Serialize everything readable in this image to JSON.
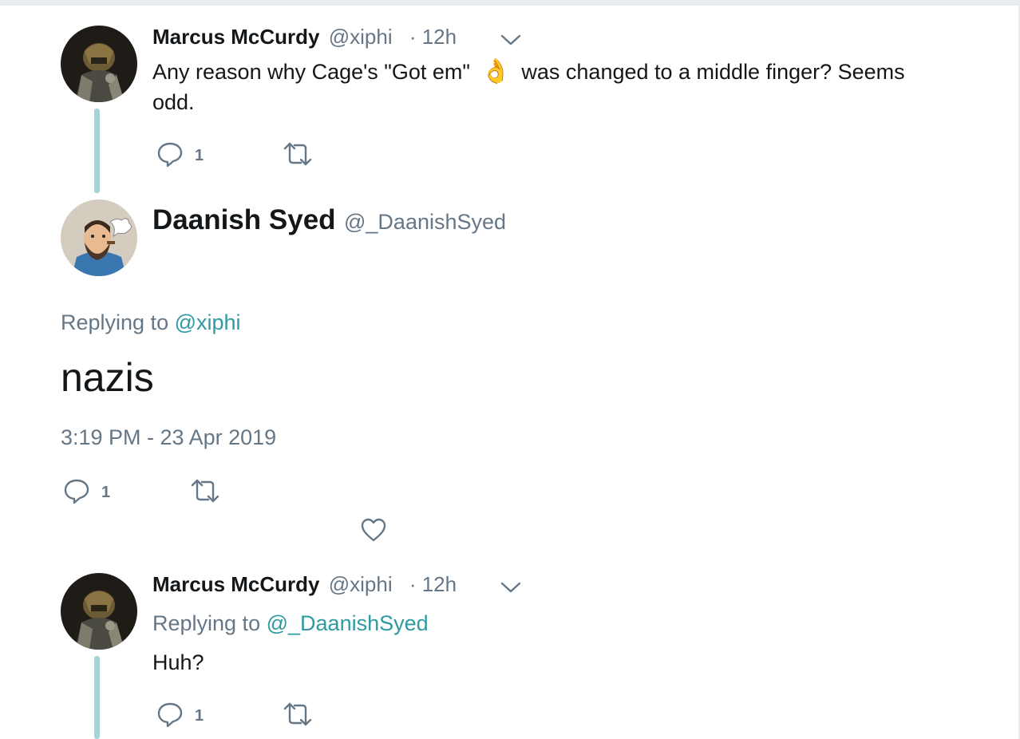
{
  "tweet1": {
    "name": "Marcus McCurdy",
    "handle": "@xiphi",
    "time": "· 12h",
    "text_before": "Any reason why Cage's \"Got em\"",
    "emoji": "👌",
    "text_after": "was changed to a middle finger? Seems",
    "text_line2": "odd.",
    "reply_count": "1"
  },
  "main_tweet": {
    "name": "Daanish Syed",
    "handle": "@_DaanishSyed",
    "replying_label": "Replying to",
    "replying_handle": "@xiphi",
    "text": "nazis",
    "timestamp": "3:19 PM - 23 Apr 2019",
    "reply_count": "1"
  },
  "tweet3": {
    "name": "Marcus McCurdy",
    "handle": "@xiphi",
    "time": "· 12h",
    "replying_label": "Replying to",
    "replying_handle": "@_DaanishSyed",
    "text": "Huh?",
    "reply_count": "1"
  },
  "icons": {
    "reply": "reply-icon",
    "retweet": "retweet-icon",
    "like": "heart-icon",
    "caret": "chevron-down-icon"
  },
  "colors": {
    "link": "#2e9aa1",
    "thread_line": "#a8d4d8",
    "secondary_text": "#657786"
  }
}
